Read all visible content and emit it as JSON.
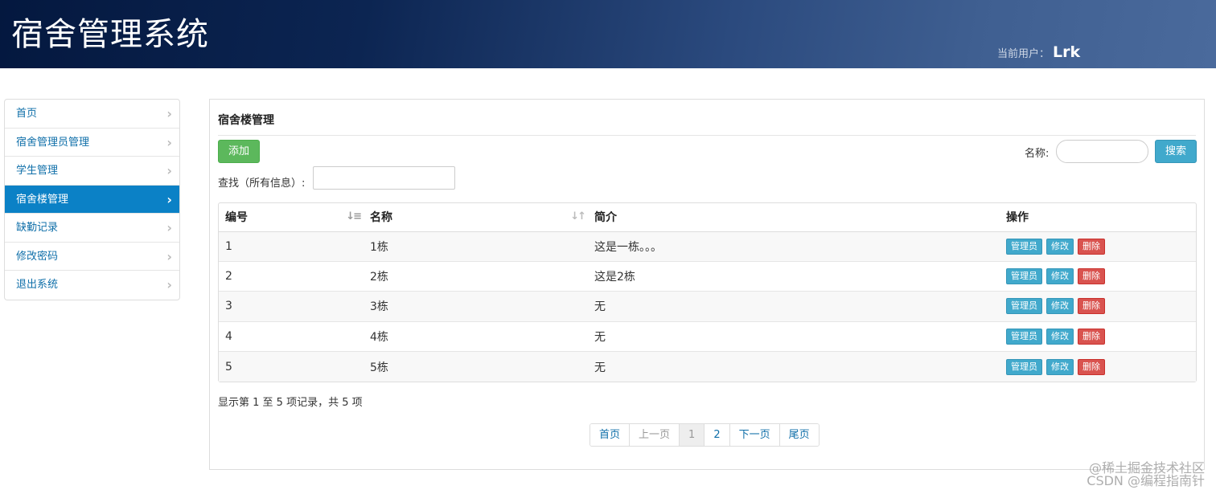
{
  "header": {
    "title": "宿舍管理系统",
    "user_label": "当前用户：",
    "user_name": "Lrk"
  },
  "sidebar": {
    "items": [
      {
        "label": "首页"
      },
      {
        "label": "宿舍管理员管理"
      },
      {
        "label": "学生管理"
      },
      {
        "label": "宿舍楼管理",
        "active": true
      },
      {
        "label": "缺勤记录"
      },
      {
        "label": "修改密码"
      },
      {
        "label": "退出系统"
      }
    ]
  },
  "main": {
    "title": "宿舍楼管理",
    "add_label": "添加",
    "name_label": "名称:",
    "search_label": "搜索",
    "find_label": "查找（所有信息）:",
    "table": {
      "headers": [
        "编号",
        "名称",
        "简介",
        "操作"
      ],
      "rows": [
        {
          "id": "1",
          "name": "1栋",
          "desc": "这是一栋。。。"
        },
        {
          "id": "2",
          "name": "2栋",
          "desc": "这是2栋"
        },
        {
          "id": "3",
          "name": "3栋",
          "desc": "无"
        },
        {
          "id": "4",
          "name": "4栋",
          "desc": "无"
        },
        {
          "id": "5",
          "name": "5栋",
          "desc": "无"
        }
      ],
      "actions": {
        "admin": "管理员",
        "edit": "修改",
        "delete": "删除"
      }
    },
    "record_info": "显示第 1 至 5 项记录，共 5 项",
    "pagination": [
      "首页",
      "上一页",
      "1",
      "2",
      "下一页",
      "尾页"
    ]
  },
  "watermark": {
    "line1": "@稀土掘金技术社区",
    "line2": "CSDN @编程指南针"
  },
  "colors": {
    "header_dark": "#04183f",
    "header_light": "#4a6a9c",
    "link": "#0f6fa9",
    "sidebar_active": "#0b81c6",
    "btn_green": "#5cb85c",
    "btn_info": "#41a9cc",
    "btn_danger": "#d9534f"
  }
}
